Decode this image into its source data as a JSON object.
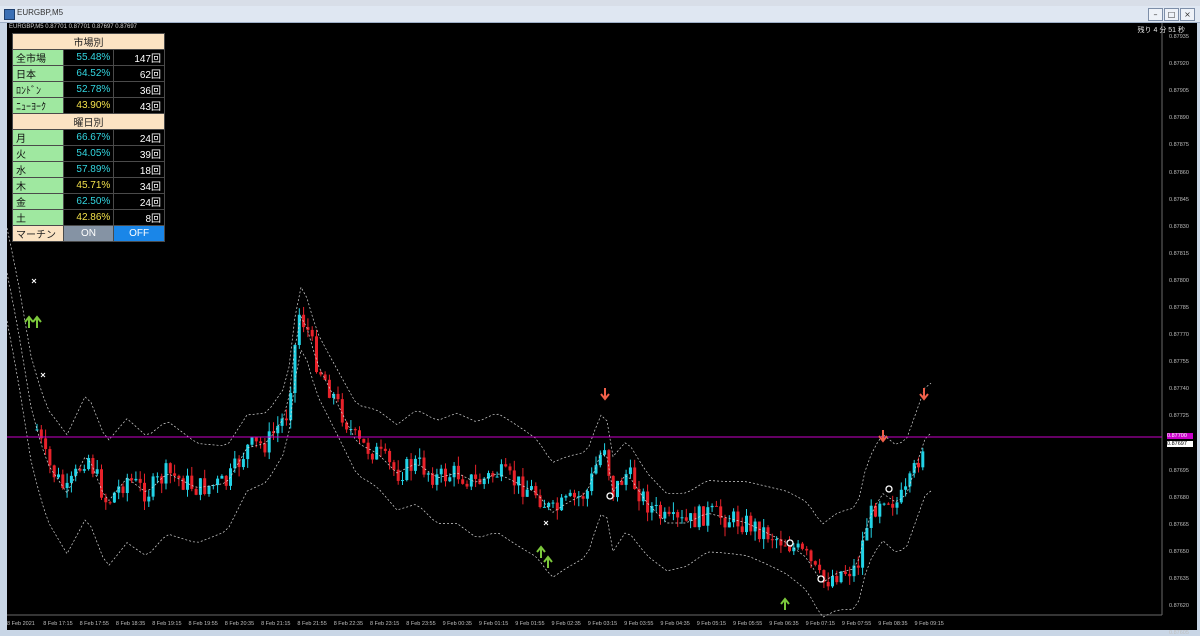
{
  "window": {
    "title": "EURGBP,M5"
  },
  "chart": {
    "symbol_line": "EURGBP,M5  0.87701 0.87701 0.87697 0.87697",
    "timer": "残り 4 分 51 秒",
    "current_price": "0.87697",
    "hline_price": "0.87700",
    "price_labels": [
      "0.87935",
      "0.87920",
      "0.87905",
      "0.87890",
      "0.87875",
      "0.87860",
      "0.87845",
      "0.87830",
      "0.87815",
      "0.87800",
      "0.87785",
      "0.87770",
      "0.87755",
      "0.87740",
      "0.87725",
      "0.87710",
      "0.87695",
      "0.87680",
      "0.87665",
      "0.87650",
      "0.87635",
      "0.87620",
      "0.87605"
    ],
    "time_labels": [
      "8 Feb 2021",
      "8 Feb 17:15",
      "8 Feb 17:55",
      "8 Feb 18:35",
      "8 Feb 19:15",
      "8 Feb 19:55",
      "8 Feb 20:35",
      "8 Feb 21:15",
      "8 Feb 21:55",
      "8 Feb 22:35",
      "8 Feb 23:15",
      "8 Feb 23:55",
      "9 Feb 00:35",
      "9 Feb 01:15",
      "9 Feb 01:55",
      "9 Feb 02:35",
      "9 Feb 03:15",
      "9 Feb 03:55",
      "9 Feb 04:35",
      "9 Feb 05:15",
      "9 Feb 05:55",
      "9 Feb 06:35",
      "9 Feb 07:15",
      "9 Feb 07:55",
      "9 Feb 08:35",
      "9 Feb 09:15"
    ]
  },
  "stats": {
    "market_header": "市場別",
    "market_rows": [
      {
        "label": "全市場",
        "pct": "55.48%",
        "count": "147回",
        "color": "cyan"
      },
      {
        "label": "日本",
        "pct": "64.52%",
        "count": "62回",
        "color": "cyan"
      },
      {
        "label": "ﾛﾝﾄﾞﾝ",
        "pct": "52.78%",
        "count": "36回",
        "color": "cyan"
      },
      {
        "label": "ﾆｭｰﾖｰｸ",
        "pct": "43.90%",
        "count": "43回",
        "color": "yellow"
      }
    ],
    "weekday_header": "曜日別",
    "weekday_rows": [
      {
        "label": "月",
        "pct": "66.67%",
        "count": "24回",
        "color": "cyan"
      },
      {
        "label": "火",
        "pct": "54.05%",
        "count": "39回",
        "color": "cyan"
      },
      {
        "label": "水",
        "pct": "57.89%",
        "count": "18回",
        "color": "cyan"
      },
      {
        "label": "木",
        "pct": "45.71%",
        "count": "34回",
        "color": "yellow"
      },
      {
        "label": "金",
        "pct": "62.50%",
        "count": "24回",
        "color": "cyan"
      },
      {
        "label": "土",
        "pct": "42.86%",
        "count": "8回",
        "color": "yellow"
      }
    ],
    "martin_label": "マーチン",
    "on_label": "ON",
    "off_label": "OFF"
  },
  "colors": {
    "bull": "#22d3e6",
    "bear": "#e8222a",
    "hline": "#c800c8",
    "band": "#d8d8d8",
    "up_arrow": "#7cc83c",
    "down_arrow": "#f0604a"
  }
}
